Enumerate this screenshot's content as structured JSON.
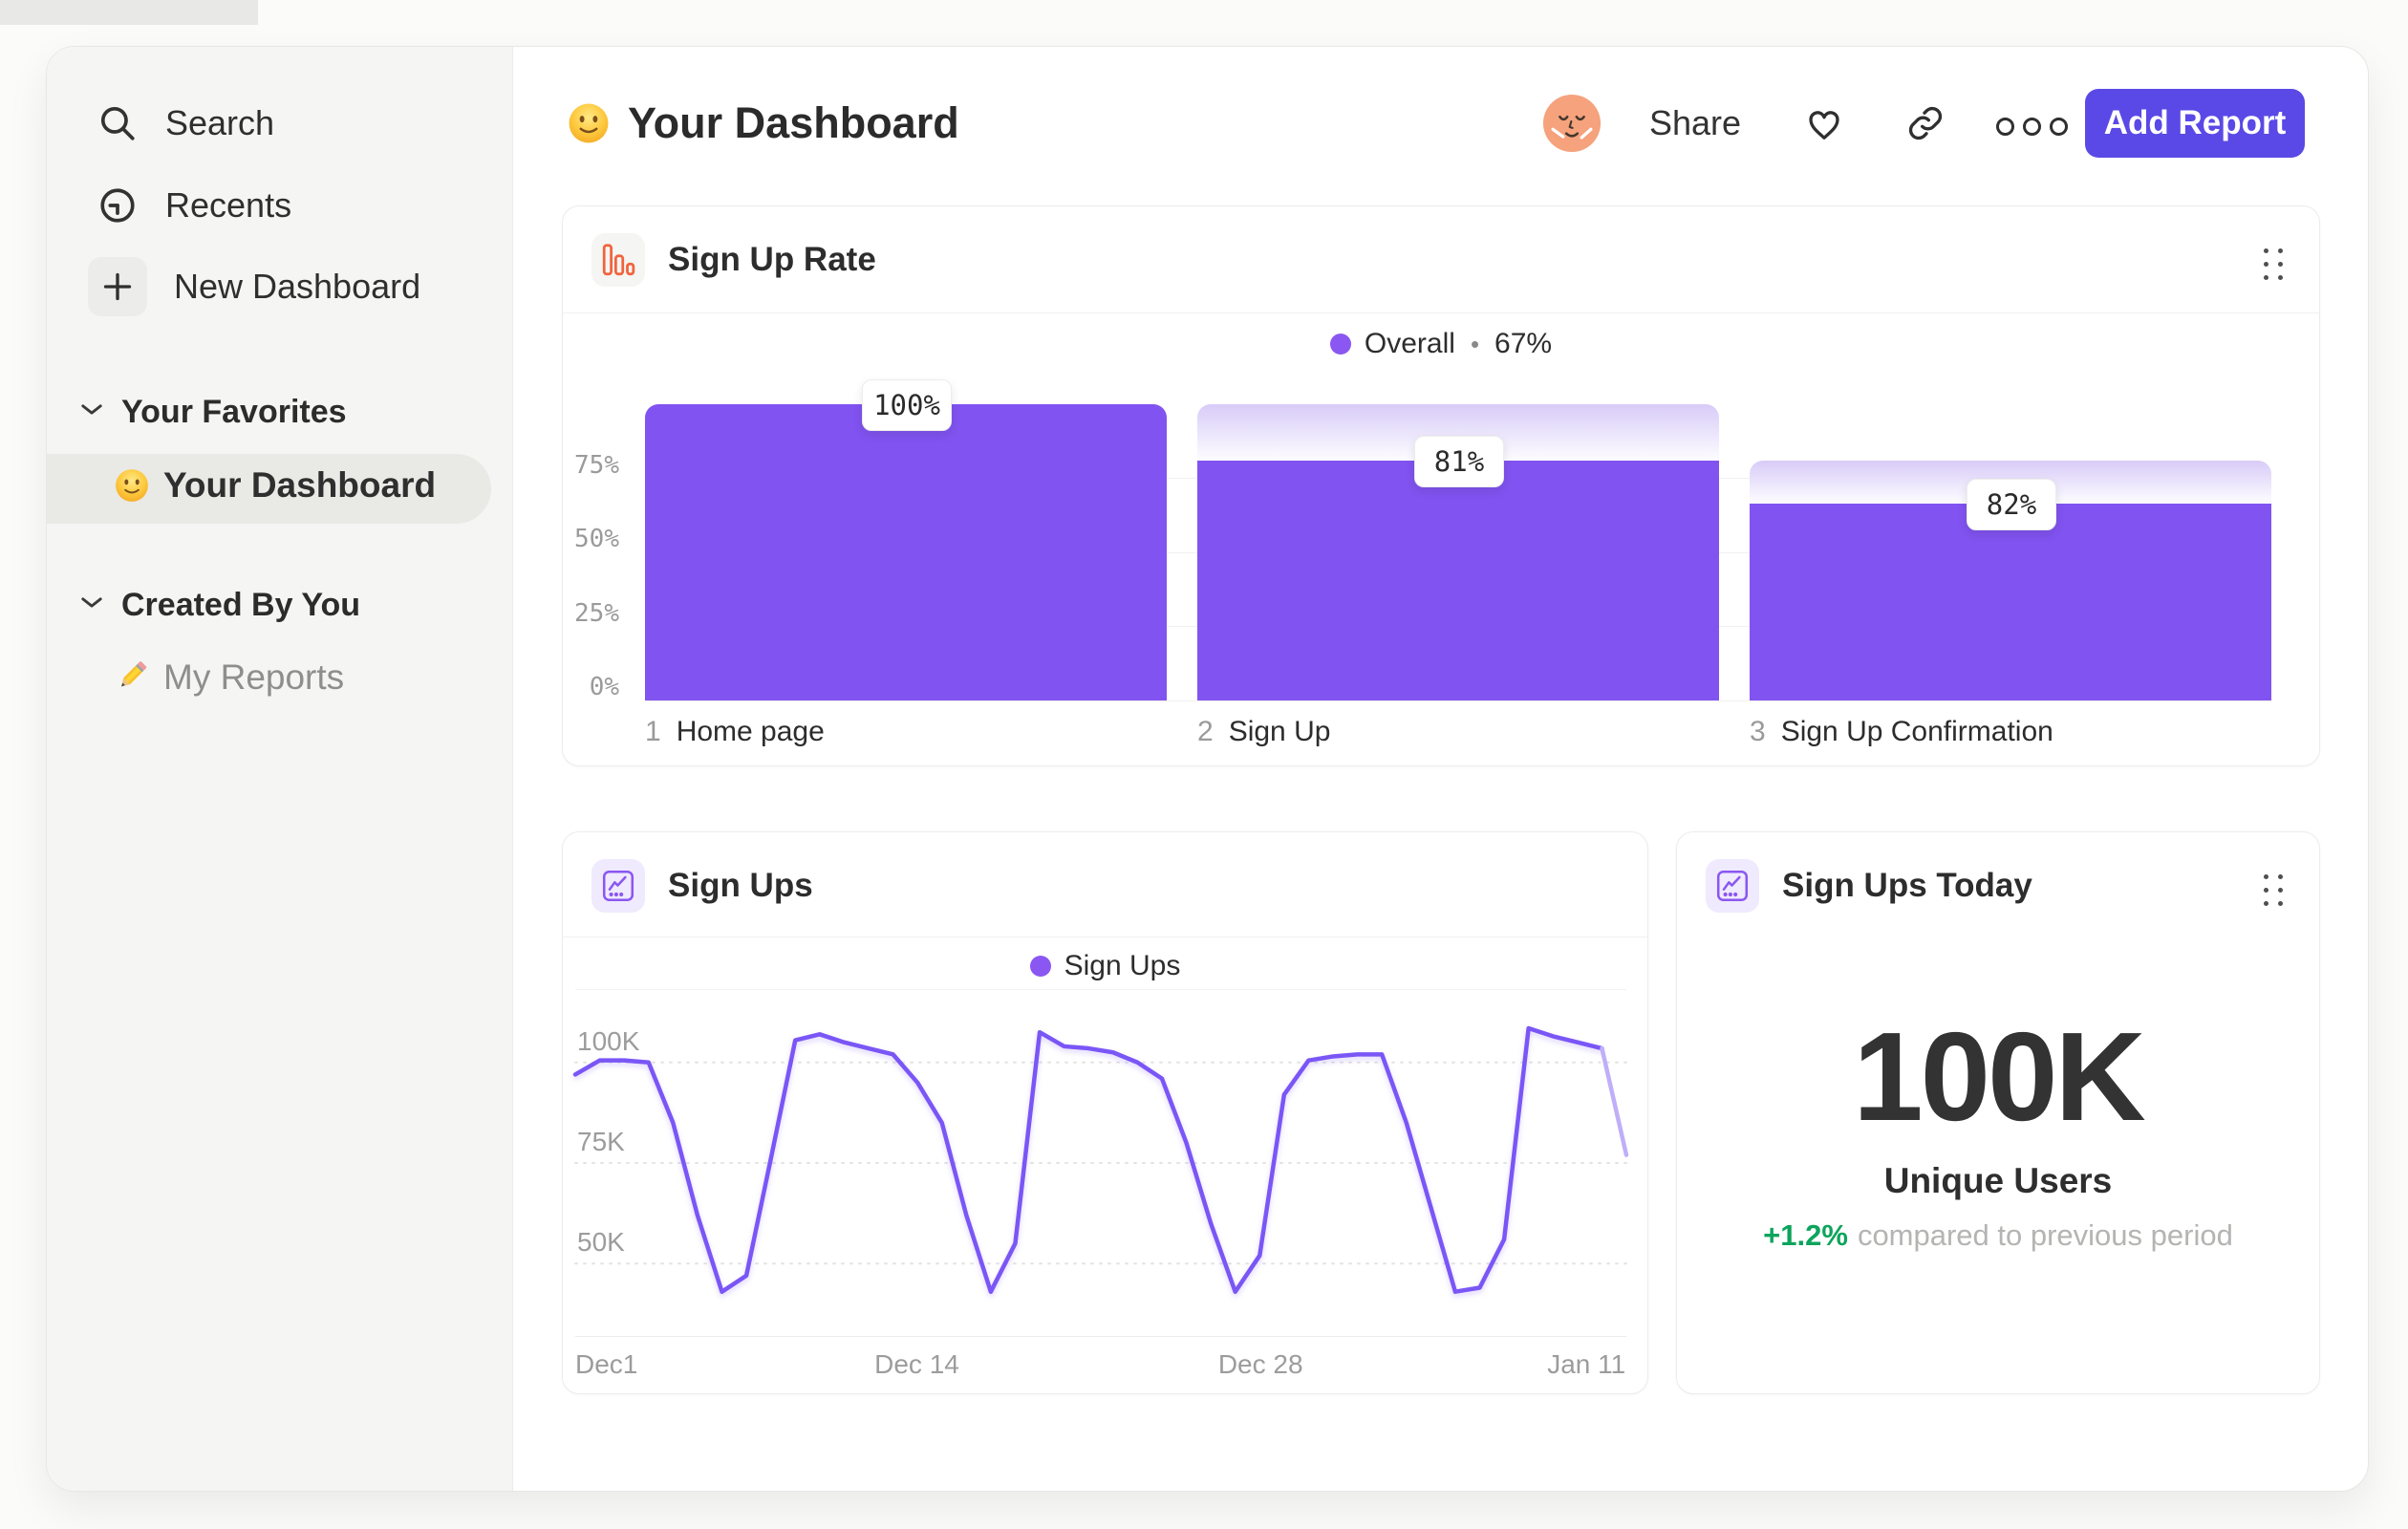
{
  "sidebar": {
    "nav": [
      {
        "icon": "search-icon",
        "label": "Search"
      },
      {
        "icon": "clock-icon",
        "label": "Recents"
      },
      {
        "icon": "plus-icon",
        "label": "New Dashboard"
      }
    ],
    "sections": [
      {
        "label": "Your Favorites",
        "items": [
          {
            "icon": "smiley-emoji",
            "label": "Your Dashboard",
            "active": true
          }
        ]
      },
      {
        "label": "Created By You",
        "items": [
          {
            "icon": "pencil-emoji",
            "label": "My Reports",
            "active": false
          }
        ]
      }
    ]
  },
  "header": {
    "title": "Your Dashboard",
    "share_label": "Share",
    "add_report_label": "Add Report"
  },
  "colors": {
    "bar_purple": "#8153f0",
    "bar_gradient_top": "#d8cbf8",
    "legend_dot": "#8b57f2",
    "line_purple": "#7a56f6",
    "line_fade": "#c0aef9",
    "button_purple": "#5a49e6",
    "funnel_icon_orange": "#f1633c",
    "positive_green": "#0da45c"
  },
  "funnel_card": {
    "title": "Sign Up Rate",
    "legend_label": "Overall",
    "legend_separator": "•",
    "legend_value": "67%",
    "y_ticks": [
      {
        "label": "75%",
        "pct": 75
      },
      {
        "label": "50%",
        "pct": 50
      },
      {
        "label": "25%",
        "pct": 25
      },
      {
        "label": "0%",
        "pct": 0
      }
    ],
    "steps": [
      {
        "number": "1",
        "label": "Home page",
        "value_label": "100%",
        "start_percent": 100,
        "percent": 100
      },
      {
        "number": "2",
        "label": "Sign Up",
        "value_label": "81%",
        "start_percent": 100,
        "percent": 81
      },
      {
        "number": "3",
        "label": "Sign Up Confirmation",
        "value_label": "82%",
        "start_percent": 81,
        "percent": 66.4
      }
    ]
  },
  "line_card": {
    "title": "Sign Ups",
    "legend_label": "Sign Ups"
  },
  "stat_card": {
    "title": "Sign Ups Today",
    "value": "100K",
    "unit_label": "Unique Users",
    "delta": "+1.2%",
    "delta_note": "compared to previous period"
  },
  "chart_data": [
    {
      "type": "bar",
      "subtype": "funnel",
      "title": "Sign Up Rate",
      "legend": [
        {
          "name": "Overall",
          "overall_conversion_pct": 67
        }
      ],
      "legend_position": "top-center",
      "categories": [
        "Home page",
        "Sign Up",
        "Sign Up Confirmation"
      ],
      "step_numbers": [
        1,
        2,
        3
      ],
      "step_conversion_pct": [
        100,
        81,
        82
      ],
      "cumulative_pct": [
        100,
        81,
        66.4
      ],
      "ylim": [
        0,
        100
      ],
      "y_ticks_pct": [
        75,
        50,
        25,
        0
      ],
      "grid": "light-horizontal"
    },
    {
      "type": "line",
      "title": "Sign Ups",
      "legend_position": "top-center",
      "series": [
        {
          "name": "Sign Ups",
          "unit": "K",
          "values": [
            97,
            100.5,
            100.5,
            100,
            85,
            62,
            43,
            47,
            76,
            105.5,
            107,
            105,
            103.5,
            102,
            95,
            85,
            62,
            43,
            55,
            107.5,
            104,
            103.5,
            102.5,
            100,
            96,
            80,
            60,
            43,
            52,
            92,
            100.5,
            101.5,
            102,
            102,
            85,
            64,
            43,
            44,
            56,
            108.5,
            106.5,
            105,
            103.5,
            77
          ]
        }
      ],
      "x_ticks": [
        {
          "label": "Dec1",
          "f": 0
        },
        {
          "label": "Dec 14",
          "f": 0.325
        },
        {
          "label": "Dec 28",
          "f": 0.652
        },
        {
          "label": "Jan 11",
          "f": 0.962
        }
      ],
      "y_ticks": [
        {
          "label": "100K",
          "value": 100
        },
        {
          "label": "75K",
          "value": 75
        },
        {
          "label": "50K",
          "value": 50
        }
      ],
      "ylim": [
        32,
        118
      ],
      "grid": "dashed-horizontal",
      "incomplete_final_segment": true
    }
  ]
}
